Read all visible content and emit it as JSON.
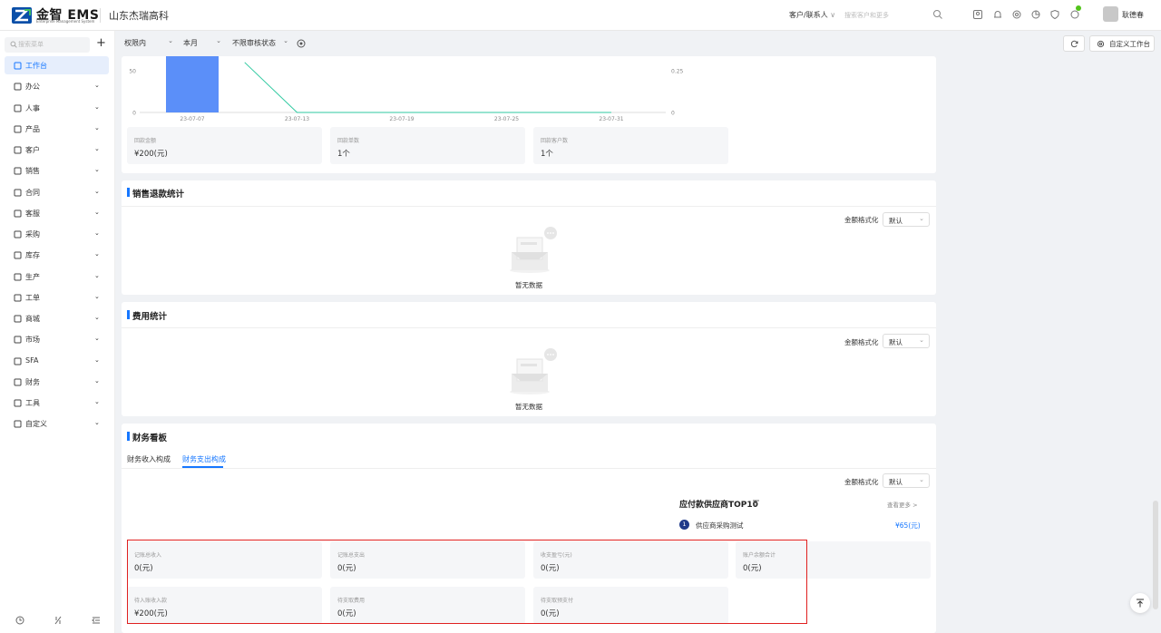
{
  "header": {
    "logo_text": "金智 EMS",
    "logo_sub": "Enterprise Management System",
    "company": "山东杰瑞高科",
    "customer_select": "客户/联系人",
    "search_placeholder": "搜索客户和更多",
    "username": "耿德春"
  },
  "sidebar": {
    "search_placeholder": "搜索菜单",
    "items": [
      {
        "label": "工作台",
        "icon": "grid-icon"
      },
      {
        "label": "办公",
        "icon": "monitor-icon"
      },
      {
        "label": "人事",
        "icon": "people-icon"
      },
      {
        "label": "产品",
        "icon": "box-icon"
      },
      {
        "label": "客户",
        "icon": "chart-icon"
      },
      {
        "label": "销售",
        "icon": "target-icon"
      },
      {
        "label": "合同",
        "icon": "document-icon"
      },
      {
        "label": "客服",
        "icon": "headset-icon"
      },
      {
        "label": "采购",
        "icon": "bag-icon"
      },
      {
        "label": "库存",
        "icon": "warehouse-icon"
      },
      {
        "label": "生产",
        "icon": "sliders-icon"
      },
      {
        "label": "工单",
        "icon": "ticket-icon"
      },
      {
        "label": "商城",
        "icon": "store-icon"
      },
      {
        "label": "市场",
        "icon": "calendar-icon"
      },
      {
        "label": "SFA",
        "icon": "clock-icon"
      },
      {
        "label": "财务",
        "icon": "bank-icon"
      },
      {
        "label": "工具",
        "icon": "toolbox-icon"
      },
      {
        "label": "自定义",
        "icon": "apps-icon"
      }
    ]
  },
  "filters": {
    "scope": "权限内",
    "period": "本月",
    "audit": "不限审核状态"
  },
  "toolbar": {
    "custom_label": "自定义工作台"
  },
  "chart_data": {
    "type": "bar",
    "categories": [
      "23-07-07",
      "23-07-13",
      "23-07-19",
      "23-07-25",
      "23-07-31"
    ],
    "y_left_ticks": [
      "50",
      "0"
    ],
    "y_right_ticks": [
      "0.25",
      "0"
    ],
    "bar_series": {
      "x": "23-07-07",
      "value": 200
    },
    "line_series_points": [
      {
        "x": "23-07-10",
        "y": 0.3
      },
      {
        "x": "23-07-13",
        "y": 0
      },
      {
        "x": "23-07-31",
        "y": 0
      }
    ],
    "colors": {
      "bar": "#5b8ff9",
      "line": "#2fc9a0"
    }
  },
  "receipt_stats": [
    {
      "label": "回款金额",
      "value": "¥200(元)"
    },
    {
      "label": "回款单数",
      "value": "1个"
    },
    {
      "label": "回款客户数",
      "value": "1个"
    }
  ],
  "refund_section": {
    "title": "销售退款统计",
    "format_label": "金额格式化",
    "format_value": "默认",
    "empty_text": "暂无数据"
  },
  "expense_section": {
    "title": "费用统计",
    "format_label": "金额格式化",
    "format_value": "默认",
    "empty_text": "暂无数据"
  },
  "finance_section": {
    "title": "财务看板",
    "tabs": [
      "财务收入构成",
      "财务支出构成"
    ],
    "active_tab": 1,
    "format_label": "金额格式化",
    "format_value": "默认",
    "top_title": "应付款供应商TOP10",
    "view_more": "查看更多 >",
    "top_list": [
      {
        "rank": "1",
        "name": "供应商采购测试",
        "amount": "¥65(元)"
      }
    ],
    "stats_row1": [
      {
        "label": "记账总收入",
        "value": "0(元)"
      },
      {
        "label": "记账总支出",
        "value": "0(元)"
      },
      {
        "label": "收支盈亏(元)",
        "value": "0(元)"
      },
      {
        "label": "账户余额合计",
        "value": "0(元)"
      }
    ],
    "stats_row2": [
      {
        "label": "待入账收入款",
        "value": "¥200(元)"
      },
      {
        "label": "待支取费用",
        "value": "0(元)"
      },
      {
        "label": "待支取预支付",
        "value": "0(元)"
      }
    ]
  },
  "colors": {
    "accent": "#1677ff",
    "highlight": "#e02020"
  }
}
